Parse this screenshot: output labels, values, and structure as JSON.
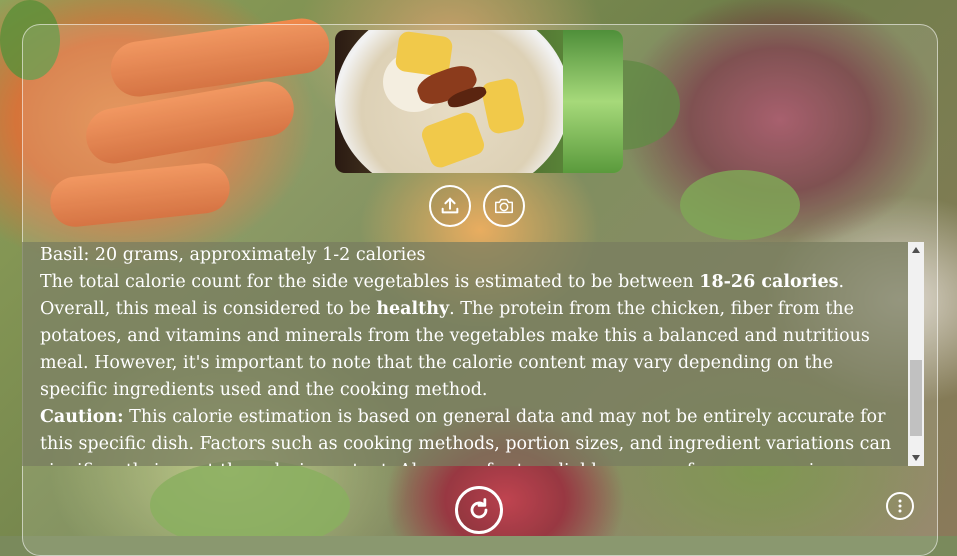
{
  "lines": {
    "basil": "Basil: 20 grams, approximately 1-2 calories",
    "total_prefix": "The total calorie count for the side vegetables is estimated to be between ",
    "total_bold": "18-26 calories",
    "total_suffix": ".",
    "overall_prefix": "Overall, this meal is considered to be ",
    "overall_bold": "healthy",
    "overall_suffix": ". The protein from the chicken, fiber from the potatoes, and vitamins and minerals from the vegetables make this a balanced and nutritious meal. However, it's important to note that the calorie content may vary depending on the specific ingredients used and the cooking method.",
    "caution_label": "Caution:",
    "caution_text": " This calorie estimation is based on general data and may not be entirely accurate for this specific dish. Factors such as cooking methods, portion sizes, and ingredient variations can significantly impact the calorie content. Always refer to reliable sources for more precise nutritional"
  },
  "icons": {
    "upload": "upload-icon",
    "camera": "camera-icon",
    "refresh": "refresh-icon",
    "more": "more-vertical-icon"
  },
  "colors": {
    "text": "#ffffff",
    "panel_border": "#ffffff"
  }
}
